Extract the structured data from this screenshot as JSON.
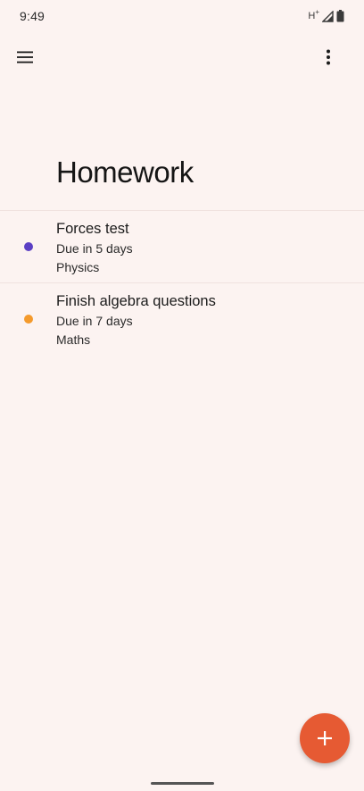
{
  "status_bar": {
    "time": "9:49",
    "network_type": "H",
    "network_suffix": "+",
    "icons": [
      "signal-icon",
      "battery-icon"
    ]
  },
  "app_bar": {
    "menu_icon": "hamburger-menu-icon",
    "overflow_icon": "more-vert-icon"
  },
  "page": {
    "title": "Homework"
  },
  "tasks": [
    {
      "title": "Forces test",
      "due": "Due in 5 days",
      "subject": "Physics",
      "color": "#5B3FC4"
    },
    {
      "title": "Finish algebra questions",
      "due": "Due in 7 days",
      "subject": "Maths",
      "color": "#F49A2C"
    }
  ],
  "fab": {
    "icon": "add-icon",
    "color": "#E65A33"
  }
}
